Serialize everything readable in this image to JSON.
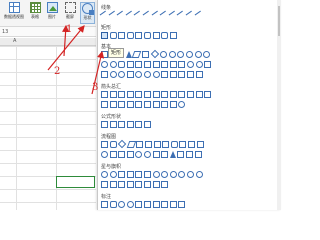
{
  "ribbon": {
    "pivot_table_label": "数据透视图",
    "table_label": "表格",
    "picture_label": "图片",
    "screenshot_label": "截屏",
    "shapes_label": "形状"
  },
  "namebox": {
    "value": "13"
  },
  "sheet": {
    "column_letter": "A"
  },
  "panel": {
    "sections": {
      "lines": "线条",
      "rectangles": "矩形",
      "basic": "基本",
      "arrows": "箭头总汇",
      "equation": "公式形状",
      "flowchart": "流程图",
      "stars": "星与旗帜",
      "callouts": "标注"
    },
    "tooltip": "矩形"
  },
  "annotations": {
    "step1": "1",
    "step2": "2",
    "step3": "3",
    "color": "#d42424"
  }
}
